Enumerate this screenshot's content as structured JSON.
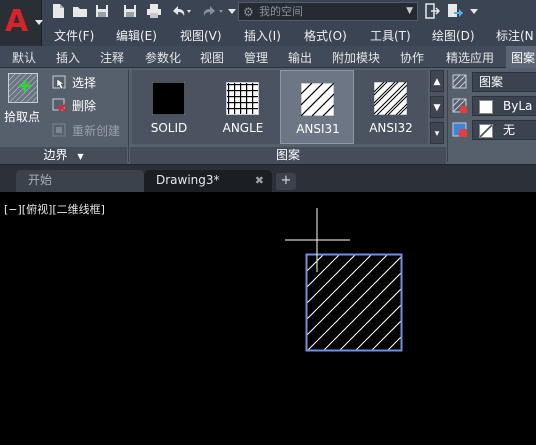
{
  "titlebar": {
    "app_letter": "A",
    "workspace_placeholder": "我的空间"
  },
  "menu": {
    "items": [
      "文件(F)",
      "编辑(E)",
      "视图(V)",
      "插入(I)",
      "格式(O)",
      "工具(T)",
      "绘图(D)",
      "标注(N"
    ]
  },
  "ribbon_tabs": {
    "items": [
      "默认",
      "插入",
      "注释",
      "参数化",
      "视图",
      "管理",
      "输出",
      "附加模块",
      "协作",
      "精选应用",
      "图案"
    ],
    "active_index": 10
  },
  "boundary_panel": {
    "title": "边界",
    "pick_label": "拾取点",
    "select_label": "选择",
    "delete_label": "删除",
    "recreate_label": "重新创建"
  },
  "pattern_panel": {
    "title": "图案",
    "patterns": [
      "SOLID",
      "ANGLE",
      "ANSI31",
      "ANSI32"
    ],
    "selected": "ANSI31"
  },
  "properties_panel": {
    "type_value": "图案",
    "color_value": "ByLa",
    "background_value": "无"
  },
  "file_tabs": {
    "start": "开始",
    "drawing": "Drawing3*",
    "close_glyph": "✖",
    "new_glyph": "+"
  },
  "canvas": {
    "viewport_label": "[−][俯视][二维线框]",
    "background": "#000000",
    "boundary_color": "#6f8fe0",
    "hatch_color": "#ffffff"
  }
}
